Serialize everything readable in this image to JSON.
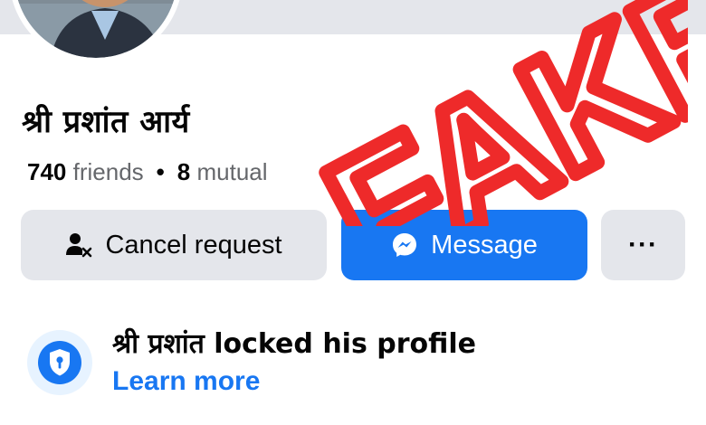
{
  "profile": {
    "name": "श्री प्रशांत आर्य",
    "friends_count": "740",
    "friends_label": "friends",
    "separator": "•",
    "mutual_count": "8",
    "mutual_label": "mutual"
  },
  "actions": {
    "cancel_request": "Cancel request",
    "message": "Message",
    "more": "···"
  },
  "lock_notice": {
    "text": "श्री प्रशांत locked his profile",
    "link": "Learn more"
  },
  "stamp": {
    "text": "FAKE",
    "color": "#ee2a2a"
  },
  "colors": {
    "accent": "#1877f2",
    "button_gray": "#e4e6eb",
    "secondary_text": "#65676b"
  },
  "icons": {
    "cancel_request": "person-remove-icon",
    "message": "messenger-icon",
    "more": "more-dots-icon",
    "lock": "shield-lock-icon"
  }
}
